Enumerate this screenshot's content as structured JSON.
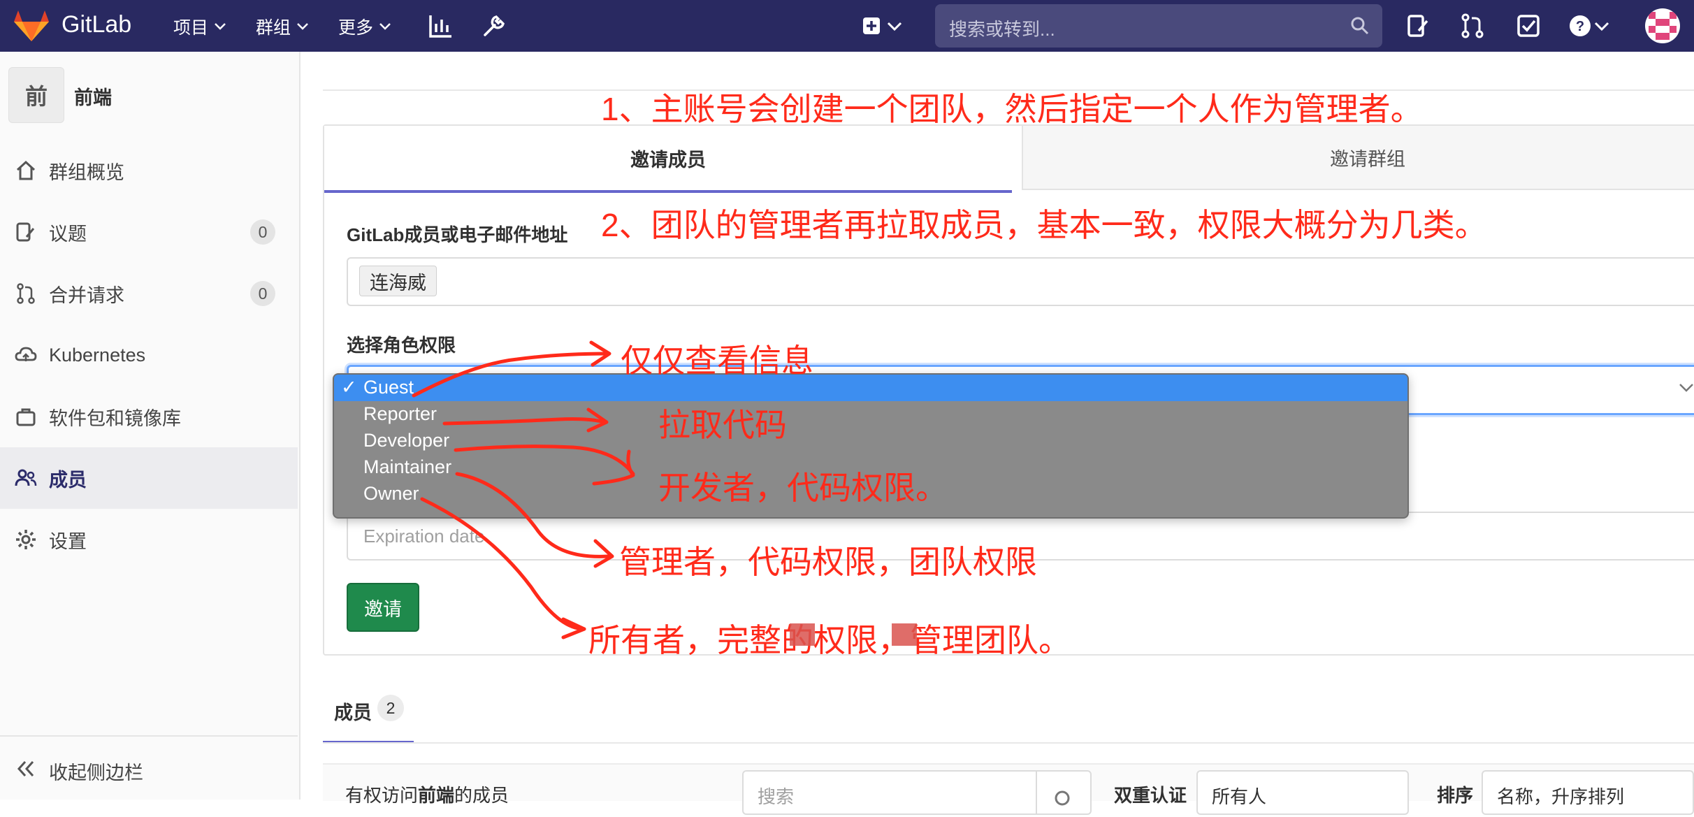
{
  "navbar": {
    "brand": "GitLab",
    "menus": [
      "项目",
      "群组",
      "更多"
    ],
    "search_placeholder": "搜索或转到..."
  },
  "sidebar": {
    "group_initial": "前",
    "group_name": "前端",
    "items": [
      {
        "label": "群组概览",
        "icon": "home-icon"
      },
      {
        "label": "议题",
        "icon": "issues-icon",
        "count": "0"
      },
      {
        "label": "合并请求",
        "icon": "merge-request-icon",
        "count": "0"
      },
      {
        "label": "Kubernetes",
        "icon": "kubernetes-cloud-icon"
      },
      {
        "label": "软件包和镜像库",
        "icon": "package-icon"
      },
      {
        "label": "成员",
        "icon": "users-icon"
      },
      {
        "label": "设置",
        "icon": "gear-icon"
      }
    ],
    "collapse_label": "收起侧边栏"
  },
  "invite": {
    "tabs": [
      "邀请成员",
      "邀请群组"
    ],
    "member_label": "GitLab成员或电子邮件地址",
    "member_token": "连海威",
    "role_label": "选择角色权限",
    "role_options": [
      "Guest",
      "Reporter",
      "Developer",
      "Maintainer",
      "Owner"
    ],
    "selected_role": "Guest",
    "selected_mark": "✓",
    "date_placeholder": "Expiration date",
    "invite_button": "邀请"
  },
  "members": {
    "tab_label": "成员",
    "count": "2",
    "desc_prefix": "有权访问",
    "desc_group": "前端",
    "desc_suffix": "的成员",
    "search_placeholder": "搜索",
    "two_factor_label": "双重认证",
    "two_factor_value": "所有人",
    "sort_label": "排序",
    "sort_value": "名称，升序排列"
  },
  "annotations": {
    "note1": "1、主账号会创建一个团队，然后指定一个人作为管理者。",
    "note2": "2、团队的管理者再拉取成员，基本一致，权限大概分为几类。",
    "guest": "仅仅查看信息",
    "reporter": "拉取代码",
    "developer": "开发者，代码权限。",
    "maintainer": "管理者，代码权限，团队权限",
    "owner": "所有者，完整的权限，管理团队。"
  },
  "colors": {
    "navbar": "#292961",
    "accent": "#6666cc",
    "invite_button": "#1f8a4c",
    "annotation_red": "#ff2a1a",
    "dropdown_selected": "#3d8ef0"
  }
}
